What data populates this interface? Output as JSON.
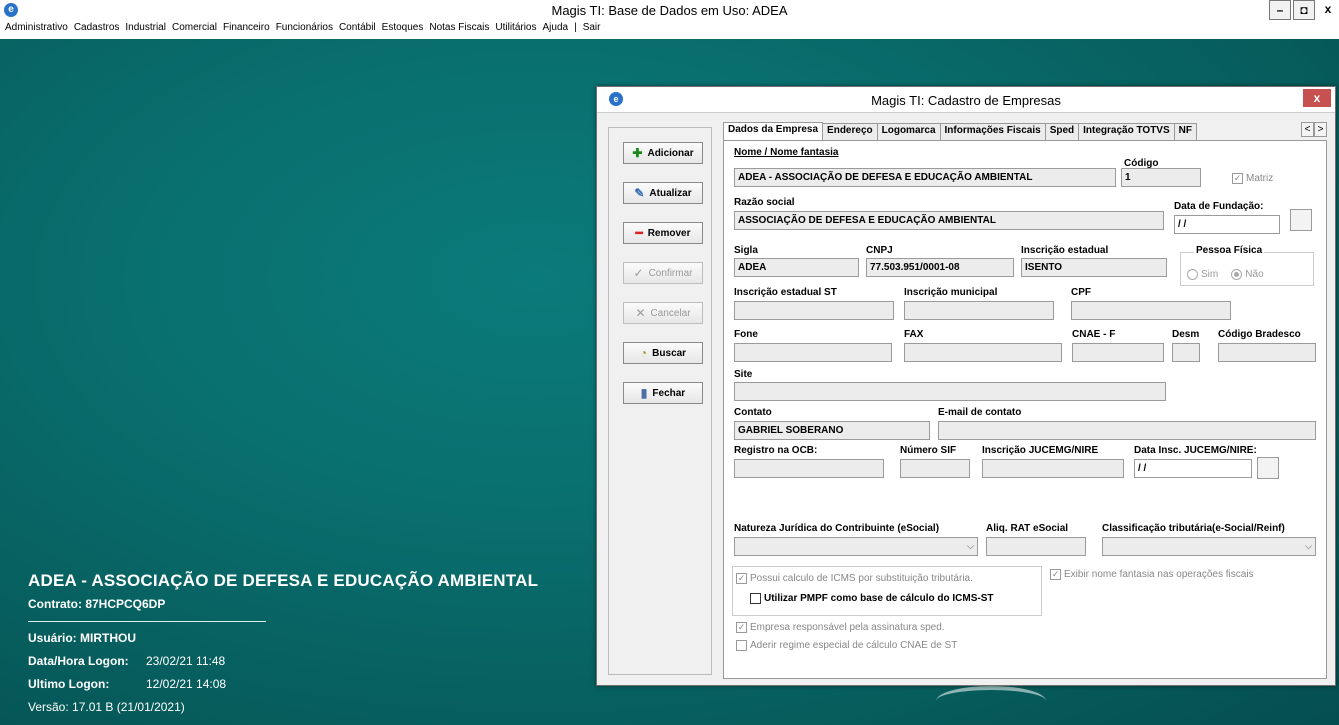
{
  "app": {
    "icon": "app-logo-icon",
    "title": "Magis TI:  Base de Dados em Uso: ADEA",
    "window_buttons": {
      "minimize": "–",
      "maximize": "◘",
      "close": "x"
    }
  },
  "menu": [
    "Administrativo",
    "Cadastros",
    "Industrial",
    "Comercial",
    "Financeiro",
    "Funcionários",
    "Contábil",
    "Estoques",
    "Notas Fiscais",
    "Utilitários",
    "Ajuda",
    "|",
    "Sair"
  ],
  "session": {
    "company": "ADEA - ASSOCIAÇÃO DE DEFESA E EDUCAÇÃO AMBIENTAL",
    "contract": "Contrato: 87HCPCQ6DP",
    "user": "Usuário: MIRTHOU",
    "logon_label": "Data/Hora Logon:",
    "logon_value": "23/02/21  11:48",
    "last_logon_label": "Ultimo Logon:",
    "last_logon_value": "12/02/21  14:08",
    "version": "Versão: 17.01 B (21/01/2021)"
  },
  "dialog": {
    "title": "Magis TI: Cadastro de Empresas",
    "close": "x",
    "buttons": {
      "add": "Adicionar",
      "update": "Atualizar",
      "remove": "Remover",
      "confirm": "Confirmar",
      "cancel": "Cancelar",
      "search": "Buscar",
      "close": "Fechar"
    },
    "tabs": [
      "Dados da Empresa",
      "Endereço",
      "Logomarca",
      "Informações Fiscais",
      "Sped",
      "Integração TOTVS",
      "NF"
    ],
    "tab_arrows": {
      "left": "<",
      "right": ">"
    },
    "form": {
      "nome_label": "Nome / Nome fantasia",
      "nome_value": "ADEA - ASSOCIAÇÃO DE DEFESA E EDUCAÇÃO AMBIENTAL",
      "codigo_label": "Código",
      "codigo_value": "1",
      "matriz_label": "Matriz",
      "razao_label": "Razão social",
      "razao_value": "ASSOCIAÇÃO DE DEFESA E EDUCAÇÃO AMBIENTAL",
      "fundacao_label": "Data de Fundação:",
      "fundacao_value": "/ /",
      "sigla_label": "Sigla",
      "sigla_value": "ADEA",
      "cnpj_label": "CNPJ",
      "cnpj_value": "77.503.951/0001-08",
      "ie_label": "Inscrição estadual",
      "ie_value": "ISENTO",
      "pf_label": "Pessoa Física",
      "pf_sim": "Sim",
      "pf_nao": "Não",
      "iest_label": "Inscrição estadual ST",
      "im_label": "Inscrição municipal",
      "cpf_label": "CPF",
      "fone_label": "Fone",
      "fax_label": "FAX",
      "cnae_label": "CNAE - F",
      "desm_label": "Desm",
      "bradesco_label": "Código Bradesco",
      "site_label": "Site",
      "contato_label": "Contato",
      "contato_value": "GABRIEL SOBERANO",
      "email_label": "E-mail de contato",
      "ocb_label": "Registro na OCB:",
      "sif_label": "Número SIF",
      "jucemg_label": "Inscrição JUCEMG/NIRE",
      "data_jucemg_label": "Data Insc. JUCEMG/NIRE:",
      "data_jucemg_value": "/ /",
      "natureza_label": "Natureza Jurídica do Contribuinte (eSocial)",
      "rat_label": "Aliq. RAT eSocial",
      "class_label": "Classificação tributária(e-Social/Reinf)",
      "icms_st_label": "Possui calculo de ICMS por substituição tributária.",
      "pmpf_label": "Utilizar PMPF como base de cálculo do ICMS-ST",
      "exibir_fantasia_label": "Exibir nome fantasia nas operações fiscais",
      "sped_label": "Empresa responsável pela assinatura sped.",
      "cnae_st_label": "Aderir regime especial de cálculo CNAE de ST"
    }
  }
}
